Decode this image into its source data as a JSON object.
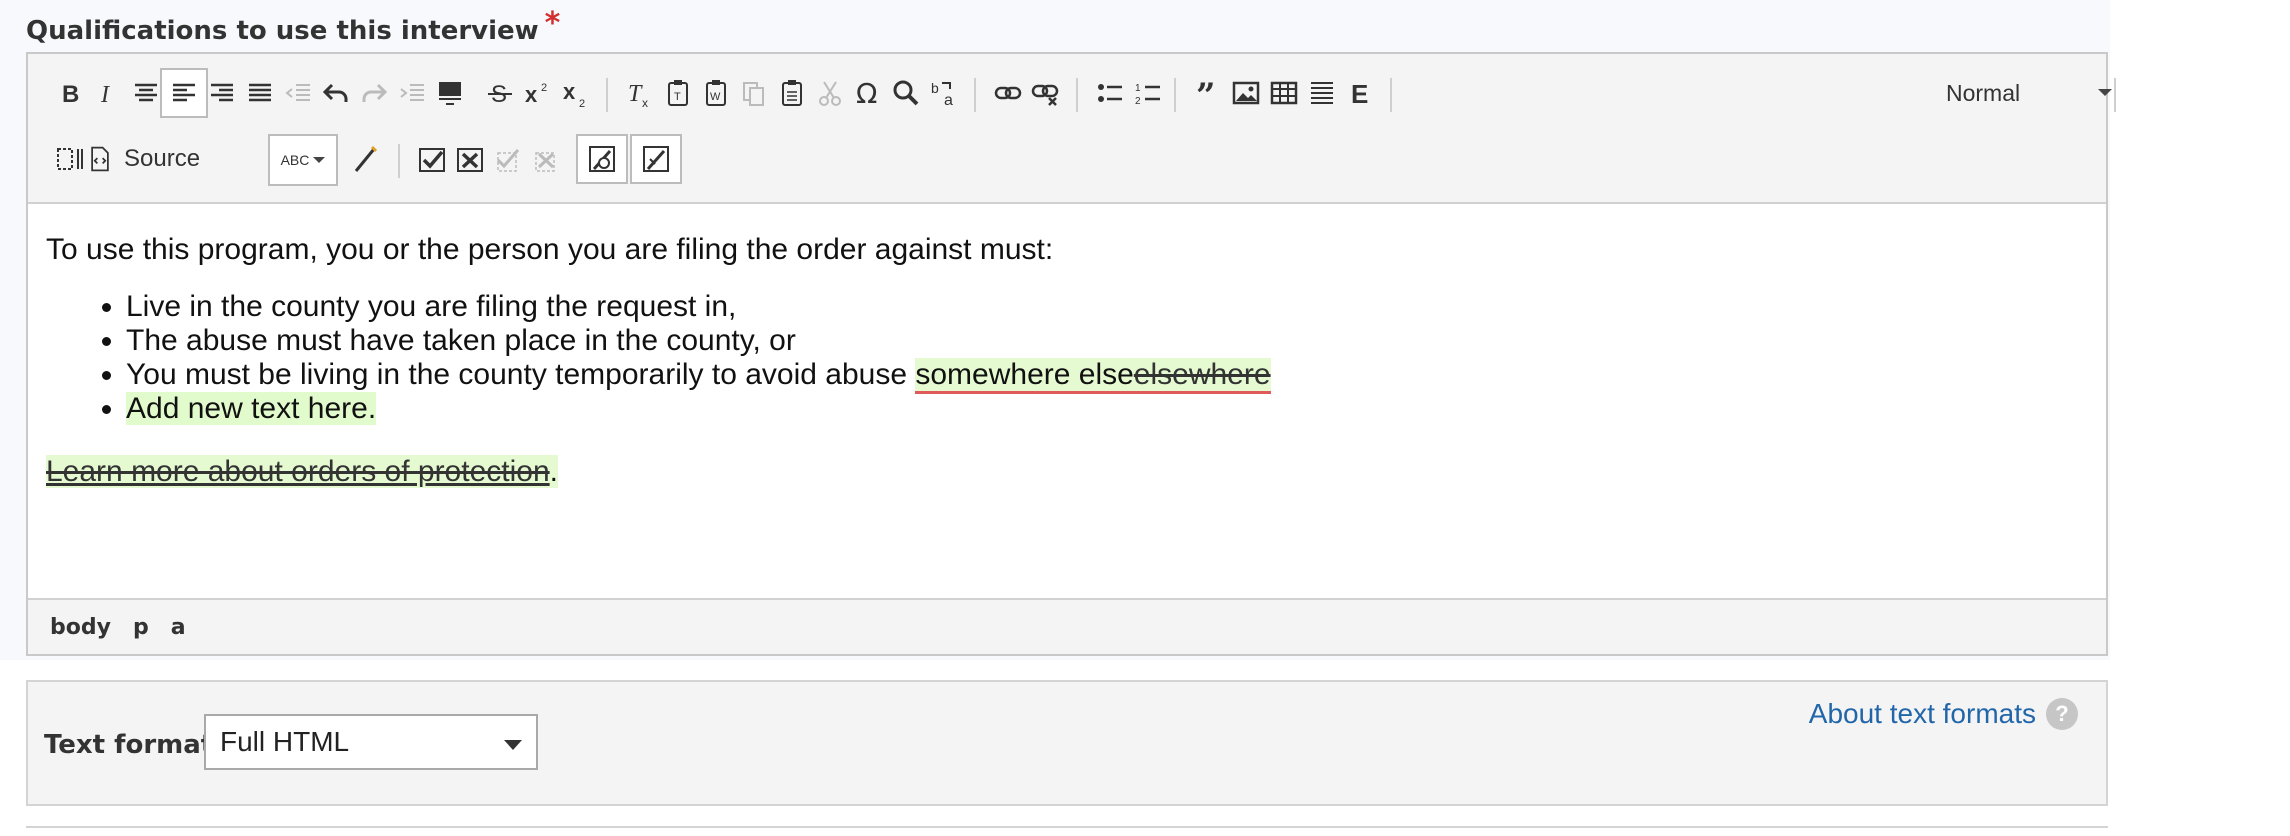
{
  "field": {
    "label": "Qualifications to use this interview",
    "required_mark": "*"
  },
  "toolbar": {
    "source_label": "Source",
    "spell_label": "ABC",
    "format_combo": "Normal"
  },
  "content": {
    "intro": "To use this program, you or the person you are filing the order against must:",
    "li1": "Live in the county you are filing the request in,",
    "li2": "The abuse must have taken place in the county, or",
    "li3_plain": "You must be living in the county temporarily to avoid abuse ",
    "li3_inserted": "somewhere else",
    "li3_deleted": "elsewhere",
    "li4_inserted": "Add new text here.",
    "learn_link": "Learn more about orders of protection",
    "learn_tail": "."
  },
  "pathbar": {
    "items": [
      "body",
      "p",
      "a"
    ]
  },
  "text_format": {
    "label": "Text format",
    "selected": "Full HTML",
    "about_link": "About text formats",
    "help": "?"
  },
  "colors": {
    "link": "#2266aa",
    "required": "#d32f2f",
    "insert_bg": "#e6fad2"
  }
}
